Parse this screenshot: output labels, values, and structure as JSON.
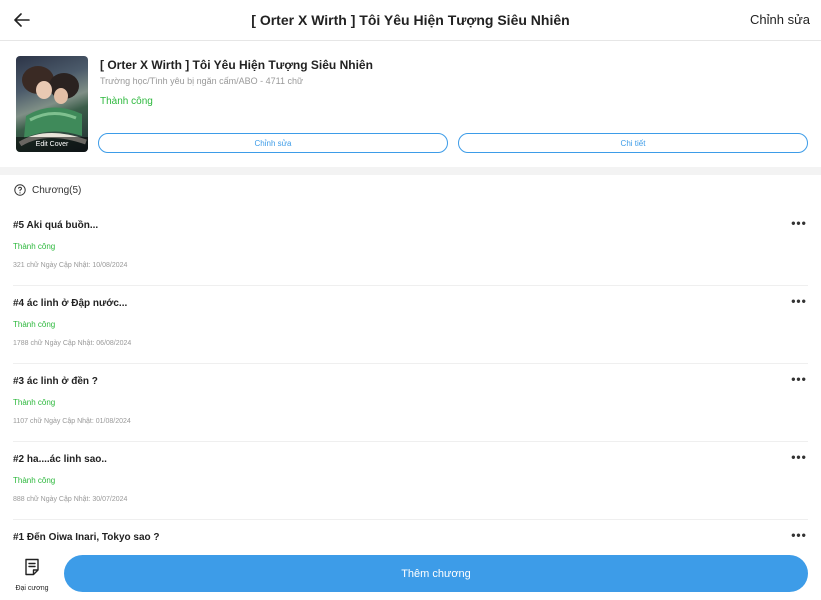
{
  "header": {
    "title": "[ Orter X Wirth ] Tôi Yêu Hiện Tượng Siêu Nhiên",
    "edit_label": "Chỉnh sửa",
    "back_icon": "arrow-left-icon"
  },
  "story": {
    "cover_label": "Edit Cover",
    "title": "[ Orter X Wirth ] Tôi Yêu Hiện Tượng Siêu Nhiên",
    "genre_line": "Trường học/Tình yêu bị ngăn cấm/ABO - 4711 chữ",
    "status": "Thành công",
    "edit_button": "Chỉnh sửa",
    "detail_button": "Chi tiết"
  },
  "chapters": {
    "heading": "Chương(5)",
    "items": [
      {
        "title": "#5 Aki quá buồn...",
        "status": "Thành công",
        "meta": "321 chữ Ngày Cập Nhật: 10/08/2024"
      },
      {
        "title": "#4 ác linh ở Đập nước...",
        "status": "Thành công",
        "meta": "1788 chữ Ngày Cập Nhật: 06/08/2024"
      },
      {
        "title": "#3 ác linh ở đền ?",
        "status": "Thành công",
        "meta": "1107 chữ Ngày Cập Nhật: 01/08/2024"
      },
      {
        "title": "#2 ha....ác linh sao..",
        "status": "Thành công",
        "meta": "888 chữ Ngày Cập Nhật: 30/07/2024"
      },
      {
        "title": "#1 Đến Oiwa Inari, Tokyo sao ?",
        "status": "",
        "meta": ""
      }
    ],
    "more_label": "•••"
  },
  "bottom": {
    "outline_label": "Đại cương",
    "add_chapter_label": "Thêm chương"
  },
  "colors": {
    "accent": "#3d9ce8",
    "success": "#2db83d"
  }
}
